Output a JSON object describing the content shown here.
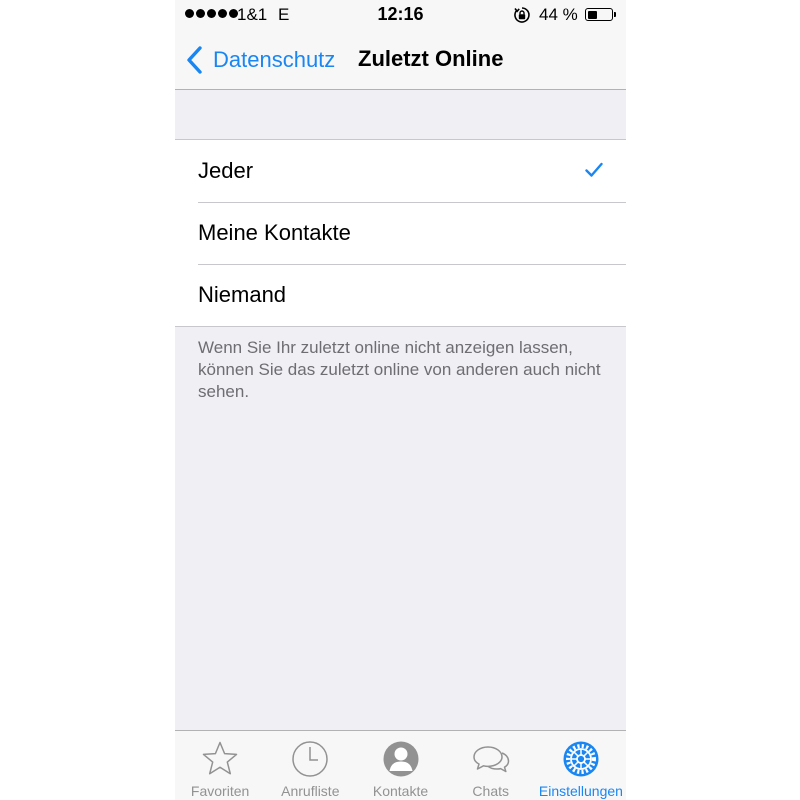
{
  "status_bar": {
    "carrier": "1&1",
    "network": "E",
    "time": "12:16",
    "battery": "44 %",
    "battery_level": 0.44
  },
  "nav": {
    "back_label": "Datenschutz",
    "title": "Zuletzt Online"
  },
  "options": [
    {
      "label": "Jeder",
      "selected": true
    },
    {
      "label": "Meine Kontakte",
      "selected": false
    },
    {
      "label": "Niemand",
      "selected": false
    }
  ],
  "footer_note": "Wenn Sie Ihr zuletzt online nicht anzeigen lassen, können Sie das zuletzt online von anderen auch nicht sehen.",
  "tabs": [
    {
      "label": "Favoriten",
      "icon": "star-icon"
    },
    {
      "label": "Anrufliste",
      "icon": "clock-icon"
    },
    {
      "label": "Kontakte",
      "icon": "contact-icon"
    },
    {
      "label": "Chats",
      "icon": "chat-bubbles-icon"
    },
    {
      "label": "Einstellungen",
      "icon": "gear-icon",
      "active": true
    }
  ],
  "colors": {
    "accent": "#1a86f2",
    "inactive_tab": "#929292",
    "background": "#efeff4"
  }
}
